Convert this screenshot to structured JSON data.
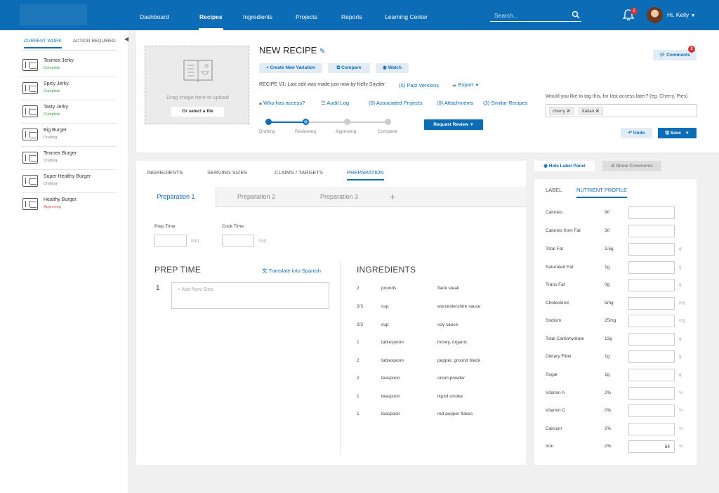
{
  "nav": {
    "items": [
      "Dashboard",
      "Recipes",
      "Ingredients",
      "Projects",
      "Reports",
      "Learning Center"
    ],
    "active": "Recipes",
    "search_placeholder": "Search...",
    "notif_count": "2",
    "greeting": "Hi, Kelly"
  },
  "sidebar": {
    "tabs": [
      "CURRENT WORK",
      "ACTION REQUIRED"
    ],
    "items": [
      {
        "name": "Texmex Jerky",
        "status": "Complete"
      },
      {
        "name": "Spicy Jerky",
        "status": "Complete"
      },
      {
        "name": "Tasty Jerky",
        "status": "Complete"
      },
      {
        "name": "Big Burger",
        "status": "Drafting"
      },
      {
        "name": "Texmex Burger",
        "status": "Drafting"
      },
      {
        "name": "Super Healthy Burger",
        "status": "Drafting"
      },
      {
        "name": "Healthy Burger",
        "status": "Approving"
      }
    ]
  },
  "colors": {
    "primary": "#0d6cb6",
    "complete": "#3aa64a",
    "drafting": "#888888",
    "approving": "#d9534f"
  },
  "header": {
    "upload_text": "Drag image here to upload",
    "select_file": "Or select a file",
    "title": "NEW RECIPE",
    "btn_variation": "+ Create New Variation",
    "btn_compare": "Compare",
    "btn_watch": "Watch",
    "edit_info": "RECIPE  V1: Last edit was made just now by Kelly Snyder",
    "past_versions": "(0) Past Versions",
    "export": "Export",
    "who_access": "Who has access?",
    "audit_log": "Audit Log",
    "assoc_projects": "(0) Associated Projects",
    "attachments": "(0) Attachments",
    "similar": "(3) Similar Recipes",
    "progress": {
      "steps": [
        "Drafting",
        "Reviewing",
        "Approving",
        "Complete"
      ],
      "current": "Reviewing"
    },
    "request_review": "Request Review",
    "comments": "Comments",
    "comments_count": "2",
    "tag_question": "Would you like to tag this, for fast access later? (eg. Cherry, Pies)",
    "tags": [
      "cherry",
      "Italian"
    ],
    "undo": "Undo",
    "save": "Save"
  },
  "main": {
    "tabs": [
      "INGREDIENTS",
      "SERVING SIZES",
      "CLAIMS / TARGETS",
      "PREPARATION"
    ],
    "active_tab": "PREPARATION",
    "prep_tabs": [
      "Preparation 1",
      "Preparation 2",
      "Preparation 3"
    ],
    "add_tab": "+",
    "prep_time_label": "Prep Time",
    "cook_time_label": "Cook Time",
    "min": "min",
    "prep_section": "PREP TIME",
    "translate": "Translate into Spanish",
    "step_number": "1",
    "step_placeholder": "+ Add New Step",
    "ingredients_section": "INGREDIENTS",
    "ingredients": [
      {
        "qty": "2",
        "unit": "pounds",
        "name": "flank steak"
      },
      {
        "qty": "2/3",
        "unit": "cup",
        "name": "worcestershire sauce"
      },
      {
        "qty": "2/3",
        "unit": "cup",
        "name": "soy sauce"
      },
      {
        "qty": "1",
        "unit": "tablespoon",
        "name": "honey, organic"
      },
      {
        "qty": "2",
        "unit": "tablespoon",
        "name": "pepper, ground black"
      },
      {
        "qty": "2",
        "unit": "teaspoon",
        "name": "onion powder"
      },
      {
        "qty": "1",
        "unit": "teaspoon",
        "name": "liquid smoke"
      },
      {
        "qty": "1",
        "unit": "teaspoon",
        "name": "red pepper flakes"
      }
    ]
  },
  "right": {
    "hide_label": "Hide Label Panel",
    "show_comments": "Show Comments",
    "tabs": [
      "LABEL",
      "NUTRIENT PROFILE"
    ],
    "active_tab": "NUTRIENT PROFILE",
    "nutrients": [
      {
        "name": "Calories",
        "value": "90",
        "unit": "",
        "input": ""
      },
      {
        "name": "Calories from Fat",
        "value": "30",
        "unit": "",
        "input": ""
      },
      {
        "name": "Total Fat",
        "value": "3.5g",
        "unit": "g",
        "input": ""
      },
      {
        "name": "Saturated Fat",
        "value": "1g",
        "unit": "g",
        "input": ""
      },
      {
        "name": "Trans Fat",
        "value": "0g",
        "unit": "g",
        "input": ""
      },
      {
        "name": "Cholesterol",
        "value": "5mg",
        "unit": "mg",
        "input": ""
      },
      {
        "name": "Sodium",
        "value": "25mg",
        "unit": "mg",
        "input": ""
      },
      {
        "name": "Total Carbohydrate",
        "value": "13g",
        "unit": "g",
        "input": ""
      },
      {
        "name": "Dietary Fiber",
        "value": "1g",
        "unit": "g",
        "input": ""
      },
      {
        "name": "Sugar",
        "value": "1g",
        "unit": "g",
        "input": ""
      },
      {
        "name": "Vitamin A",
        "value": "2%",
        "unit": "%",
        "input": ""
      },
      {
        "name": "Vitamin C",
        "value": "0%",
        "unit": "%",
        "input": ""
      },
      {
        "name": "Calcium",
        "value": "2%",
        "unit": "%",
        "input": ""
      },
      {
        "name": "Iron",
        "value": "2%",
        "unit": "%",
        "input": "54"
      }
    ]
  }
}
